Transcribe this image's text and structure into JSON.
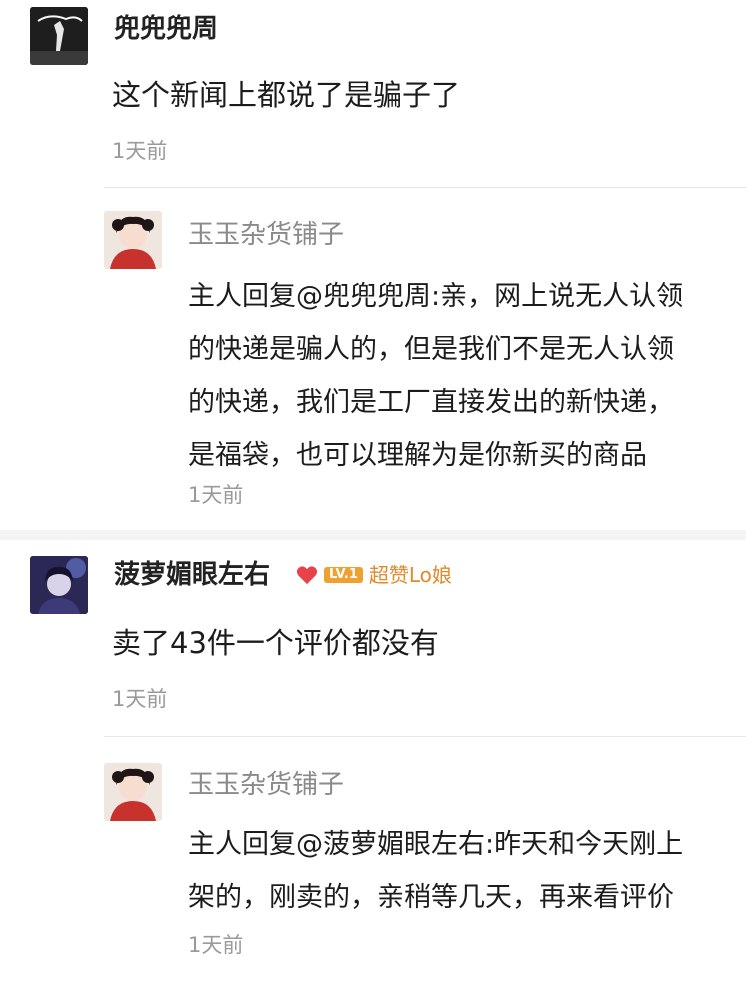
{
  "thread1": {
    "user": {
      "name": "兜兜兜周",
      "comment": "这个新闻上都说了是骗子了",
      "time": "1天前"
    },
    "reply": {
      "name": "玉玉杂货铺子",
      "lines": [
        "主人回复@兜兜兜周:亲，网上说无人认领",
        "的快递是骗人的，但是我们不是无人认领",
        "的快递，我们是工厂直接发出的新快递，",
        "是福袋，也可以理解为是你新买的商品"
      ],
      "time": "1天前"
    }
  },
  "thread2": {
    "user": {
      "name": "菠萝媚眼左右",
      "level": "LV.1",
      "title_badge": "超赞Lo娘",
      "comment": "卖了43件一个评价都没有",
      "time": "1天前"
    },
    "reply": {
      "name": "玉玉杂货铺子",
      "lines": [
        "主人回复@菠萝媚眼左右:昨天和今天刚上",
        "架的，刚卖的，亲稍等几天，再来看评价"
      ],
      "time": "1天前"
    }
  },
  "colors": {
    "username": "#222222",
    "shopname": "#8a8a8a",
    "time": "#9a9a9a",
    "badge_orange": "#f0a030",
    "heart_red": "#e8434b"
  },
  "icons": {
    "heart": "heart-icon"
  }
}
